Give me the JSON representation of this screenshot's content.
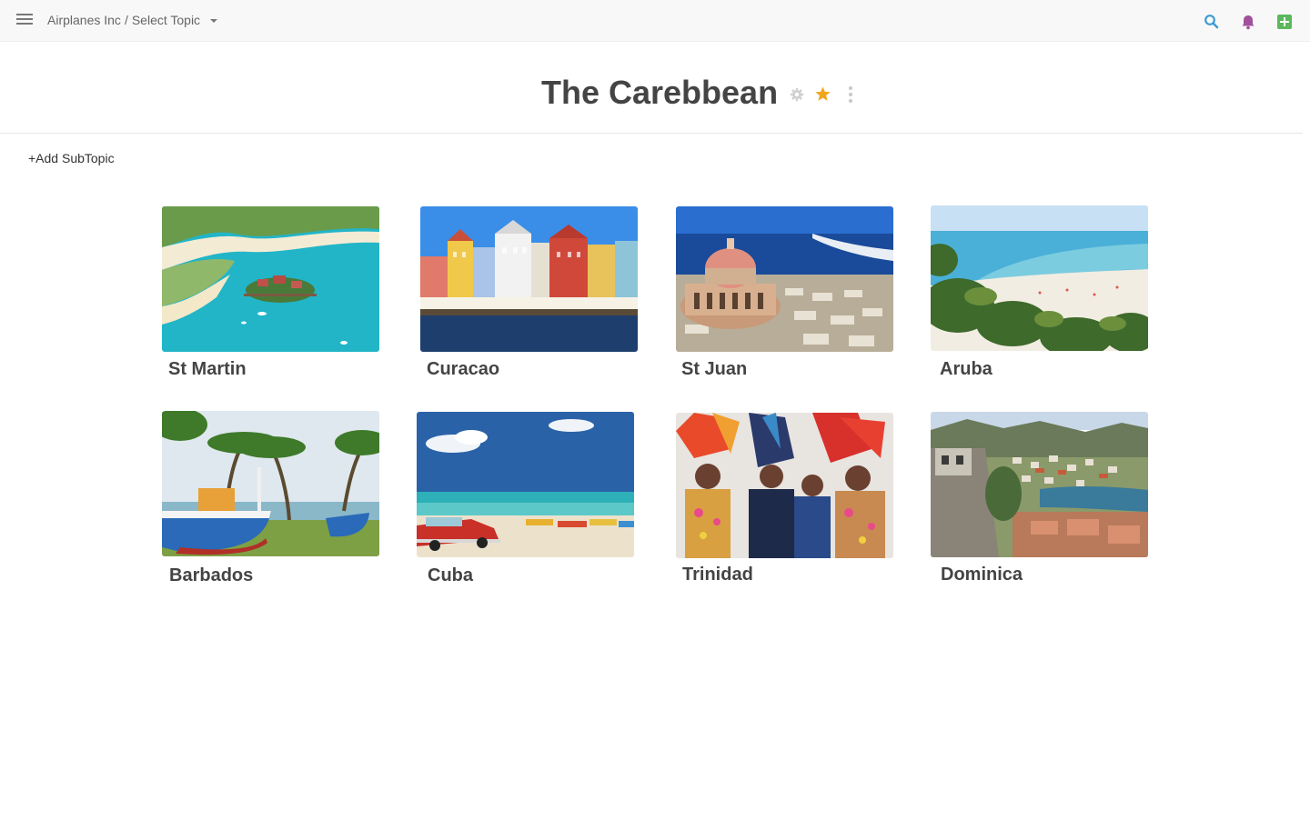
{
  "topbar": {
    "company": "Airplanes Inc",
    "separator": "/",
    "topic_selector": "Select Topic",
    "icons": {
      "menu": "menu-icon",
      "search": "search-icon",
      "bell": "bell-icon",
      "add": "add-icon"
    },
    "colors": {
      "search": "#3b9bd4",
      "bell": "#a0509c",
      "add": "#5cb85c"
    }
  },
  "page": {
    "title": "The Carebbean",
    "icons": {
      "settings": "gear-icon",
      "favorite": "star-icon",
      "more": "more-vertical-icon"
    },
    "colors": {
      "star": "#f0a51c",
      "gear": "#d0d0d0"
    }
  },
  "actions": {
    "add_subtopic": "+Add SubTopic"
  },
  "subtopics": [
    {
      "name": "St Martin",
      "image": "aerial turquoise bay with island resort"
    },
    {
      "name": "Curacao",
      "image": "colorful waterfront buildings"
    },
    {
      "name": "St Juan",
      "image": "domed chapel by the ocean"
    },
    {
      "name": "Aruba",
      "image": "palm-lined white beach"
    },
    {
      "name": "Barbados",
      "image": "blue boat under palm trees"
    },
    {
      "name": "Cuba",
      "image": "red classic car on beach"
    },
    {
      "name": "Trinidad",
      "image": "carnival dancers with feathers"
    },
    {
      "name": "Dominica",
      "image": "hillside harbor town"
    }
  ]
}
